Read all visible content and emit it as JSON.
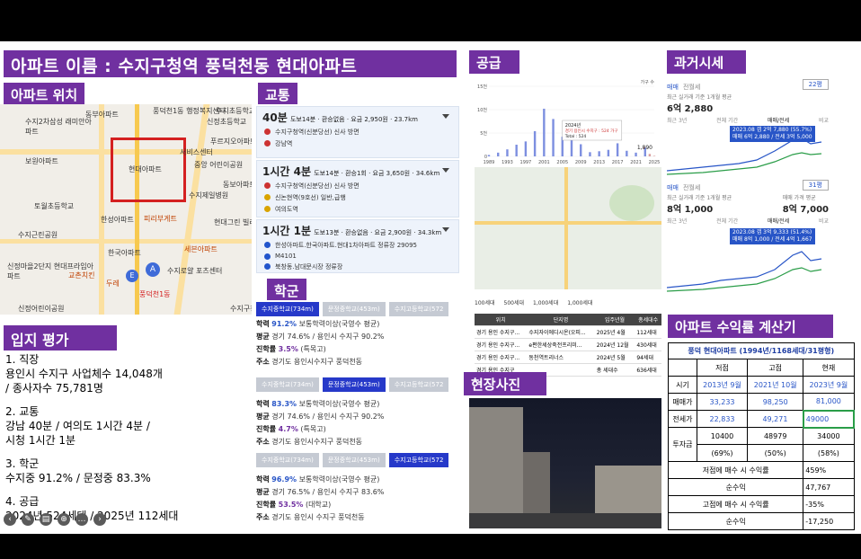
{
  "main_title": "아파트 이름 : 수지구청역 풍덕천동 현대아파트",
  "sections": {
    "location": "아파트 위치",
    "transit": "교통",
    "school": "학군",
    "evaluation": "입지 평가",
    "supply": "공급",
    "photo": "현장사진",
    "price_history": "과거시세",
    "calculator": "아파트 수익률 계산기"
  },
  "map_labels": [
    "풍덕천1동 행정복지센터",
    "동부아파트",
    "수지초등학교",
    "수지2차삼성 래미안아파트",
    "신정초등학교",
    "보원아파트",
    "서비스센터",
    "푸르지오아파트",
    "현대아파트",
    "중앙 어린이공원",
    "동보아파트",
    "토월초등학교",
    "수지제일병원",
    "한성아파트",
    "피리부게트",
    "현대그린 빌라",
    "한국아파트",
    "수지근린공원",
    "세븐아파트",
    "신정마을2단지 현대프라임아파트",
    "교촌치킨",
    "수지로얄 포츠센터",
    "신정어린이공원",
    "두레",
    "풍덕천1동",
    "수지구청"
  ],
  "transit": {
    "routes": [
      {
        "time": "40분",
        "detail": "도보14분 · 환승없음 · 요금 2,950원 · 23.7km",
        "stops": [
          "수지구청역(신분당선) 신사 방면",
          "강남역"
        ]
      },
      {
        "time": "1시간 4분",
        "detail": "도보14분 · 환승1회 · 요금 3,650원 · 34.6km",
        "stops": [
          "수지구청역(신분당선) 신사 방면",
          "신논현역(9호선) 일반,급행",
          "여의도역"
        ]
      },
      {
        "time": "1시간 1분",
        "detail": "도보13분 · 환승없음 · 요금 2,900원 · 34.3km",
        "stops": [
          "한성아파트.한국아파트.현대1차아파트 정류장 29095",
          "M4101",
          "북창동.남대문시장 정류장"
        ]
      }
    ]
  },
  "schools": [
    {
      "tabs": [
        "수지중학교(734m)",
        "문정중학교(453m)",
        "수지고등학교(572"
      ],
      "active": 0,
      "rate": "91.2%",
      "rate_note": "보통학력이상(국영수 평균)",
      "avg": "경기 74.6% / 용인시 수지구 90.2%",
      "advance": "3.5%",
      "advance_note": "(특목고)",
      "addr": "경기도 용인시수지구 풍덕천동"
    },
    {
      "tabs": [
        "수지중학교(734m)",
        "문정중학교(453m)",
        "수지고등학교(572"
      ],
      "active": 1,
      "rate": "83.3%",
      "rate_note": "보통학력이상(국영수 평균)",
      "avg": "경기 74.6% / 용인시 수지구 90.2%",
      "advance": "4.7%",
      "advance_note": "(특목고)",
      "addr": "경기도 용인시수지구 풍덕천동"
    },
    {
      "tabs": [
        "수지중학교(734m)",
        "문정중학교(453m)",
        "수지고등학교(572"
      ],
      "active": 2,
      "rate": "96.9%",
      "rate_note": "보통학력이상(국영수 평균)",
      "avg": "경기 76.5% / 용인시 수지구 83.6%",
      "advance": "53.5%",
      "advance_note": "(대학교)",
      "addr": "경기도 용인시 수지구 풍덕천동"
    }
  ],
  "school_labels": {
    "rate": "학력",
    "avg": "평균",
    "advance": "진학률",
    "addr": "주소"
  },
  "evaluation": [
    {
      "head": "1. 직장",
      "lines": [
        "용인시 수지구 사업체수 14,048개",
        "/ 종사자수 75,781명"
      ]
    },
    {
      "head": "2. 교통",
      "lines": [
        "강남 40분 / 여의도 1시간 4분 /",
        "시청 1시간 1분"
      ]
    },
    {
      "head": "3. 학군",
      "lines": [
        "수지중 91.2% / 문정중 83.3%"
      ]
    },
    {
      "head": "4. 공급",
      "lines": [
        "2024년 524세대 / 2025년 112세대"
      ]
    }
  ],
  "supply_chart": {
    "unit": "가구 수",
    "yticks": [
      "15천",
      "10천",
      "5천",
      "0"
    ],
    "xticks": [
      "1989",
      "1993",
      "1997",
      "2001",
      "2005",
      "2009",
      "2013",
      "2017",
      "2021",
      "2025"
    ],
    "tooltip_title": "2024년",
    "tooltip_line": "경기 용인시 수지구 : 524 가구",
    "tooltip_sum": "Total : 524",
    "callout": "1,890"
  },
  "chart_data": {
    "type": "bar",
    "x": [
      1989,
      1991,
      1993,
      1995,
      1997,
      1999,
      2001,
      2003,
      2005,
      2007,
      2009,
      2011,
      2013,
      2015,
      2017,
      2019,
      2021,
      2023,
      2024,
      2025
    ],
    "values": [
      300,
      800,
      1500,
      2500,
      3200,
      5400,
      10200,
      8000,
      4200,
      6800,
      2600,
      900,
      1100,
      1400,
      2800,
      1200,
      800,
      1890,
      524,
      112
    ],
    "ylim": [
      0,
      15000
    ]
  },
  "supply_legend": [
    "100세대",
    "500세대",
    "1,000세대",
    "1,000세대"
  ],
  "supply_table": {
    "headers": [
      "위치",
      "단지명",
      "입주년월",
      "총세대수"
    ],
    "rows": [
      [
        "경기 용인 수지구...",
        "수지자이에디시온(오피...",
        "2025년 4월",
        "112세대"
      ],
      [
        "경기 용인 수지구...",
        "e편한세상죽전프리미...",
        "2024년 12월",
        "430세대"
      ],
      [
        "경기 용인 수지구...",
        "동천역트리너스",
        "2024년 5월",
        "94세대"
      ],
      [
        "경기 용인 수지구",
        "",
        "총 세대수",
        "636세대"
      ]
    ]
  },
  "price_top": {
    "tabs": [
      "매매",
      "전월세"
    ],
    "area": "22평",
    "note": "최근 실거래 기준 1개월 평균",
    "price": "6억 2,880",
    "subtabs": [
      "최근 3년",
      "전체 기간",
      "매매/전세",
      "비교"
    ],
    "tooltip": "2023.08 갭 2억 7,880 (55.7%)",
    "tooltip2": "매매 6억 2,880 / 전세 3억 5,000"
  },
  "price_bottom": {
    "tabs": [
      "매매",
      "전월세"
    ],
    "area": "31평",
    "note": "최근 실거래 기준 1개월 평균",
    "price": "8억 1,000",
    "note2": "매매 가격 평균",
    "price2": "8억 7,000",
    "subtabs": [
      "최근 3년",
      "전체 기간",
      "매매/전세",
      "비교"
    ],
    "tooltip": "2023.08 갭 3억 9,333 (51.4%)",
    "tooltip2": "매매 8억 1,000 / 전세 4억 1,667"
  },
  "calc": {
    "title": "풍덕 현대아파트 (1994년/1168세대/31평형)",
    "cols": [
      "저점",
      "고점",
      "현재"
    ],
    "period_label": "시기",
    "periods": [
      "2013년 9월",
      "2021년 10월",
      "2023년 9월"
    ],
    "sale_label": "매매가",
    "sale": [
      "33,233",
      "98,250",
      "81,000"
    ],
    "lease_label": "전세가",
    "lease": [
      "22,833",
      "49,271",
      "49000"
    ],
    "invest_label": "투자금",
    "invest": [
      "10400",
      "48979",
      "34000"
    ],
    "invest_pct": [
      "(69%)",
      "(50%)",
      "(58%)"
    ],
    "rows": [
      [
        "저점에 매수 시 수익률",
        "459%"
      ],
      [
        "순수익",
        "47,767"
      ],
      [
        "고점에 매수 시 수익률",
        "-35%"
      ],
      [
        "순수익",
        "-17,250"
      ]
    ]
  }
}
